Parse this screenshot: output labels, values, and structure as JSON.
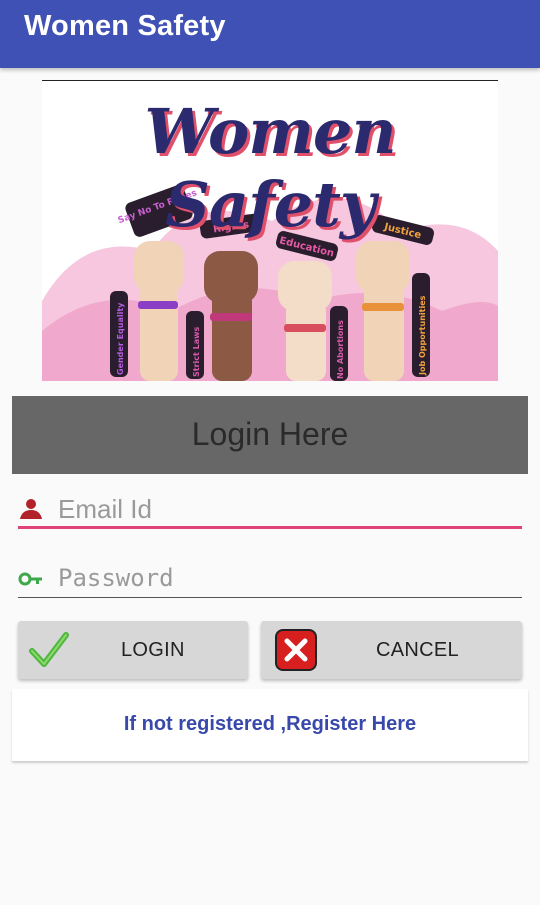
{
  "app": {
    "title": "Women Safety"
  },
  "banner": {
    "title": "Women Safety",
    "signs": [
      "Say No To Rapes",
      "Rights",
      "Education",
      "Justice",
      "Gender Equality",
      "Strict Laws",
      "No Abortions",
      "Job Opportunities"
    ]
  },
  "login": {
    "header": "Login Here",
    "email_placeholder": "Email Id",
    "password_placeholder": "Password",
    "login_label": "LOGIN",
    "cancel_label": "CANCEL",
    "register_link": "If not registered ,Register Here"
  },
  "icons": {
    "email": "person-icon",
    "password": "key-icon",
    "login": "checkmark-icon",
    "cancel": "close-icon"
  },
  "colors": {
    "appbar": "#3f51b5",
    "accent": "#e0427a",
    "link": "#3949ab",
    "header_bg": "#676767",
    "button_bg": "#d7d7d7"
  }
}
